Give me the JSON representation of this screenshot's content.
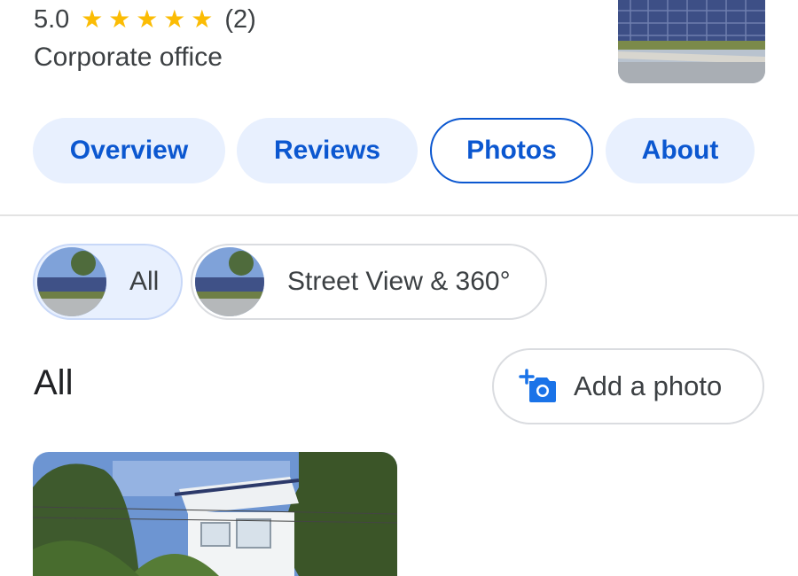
{
  "place": {
    "rating": "5.0",
    "review_count": "(2)",
    "stars": 5,
    "category": "Corporate office"
  },
  "tabs": [
    {
      "label": "Overview"
    },
    {
      "label": "Reviews"
    },
    {
      "label": "Photos"
    },
    {
      "label": "About"
    }
  ],
  "active_tab": "Photos",
  "filters": [
    {
      "label": "All"
    },
    {
      "label": "Street View & 360°"
    }
  ],
  "section": {
    "title": "All",
    "add_photo_label": "Add a photo"
  },
  "colors": {
    "accent": "#0b57d0",
    "tab_bg": "#e8f0fe",
    "star": "#fbbc04"
  }
}
